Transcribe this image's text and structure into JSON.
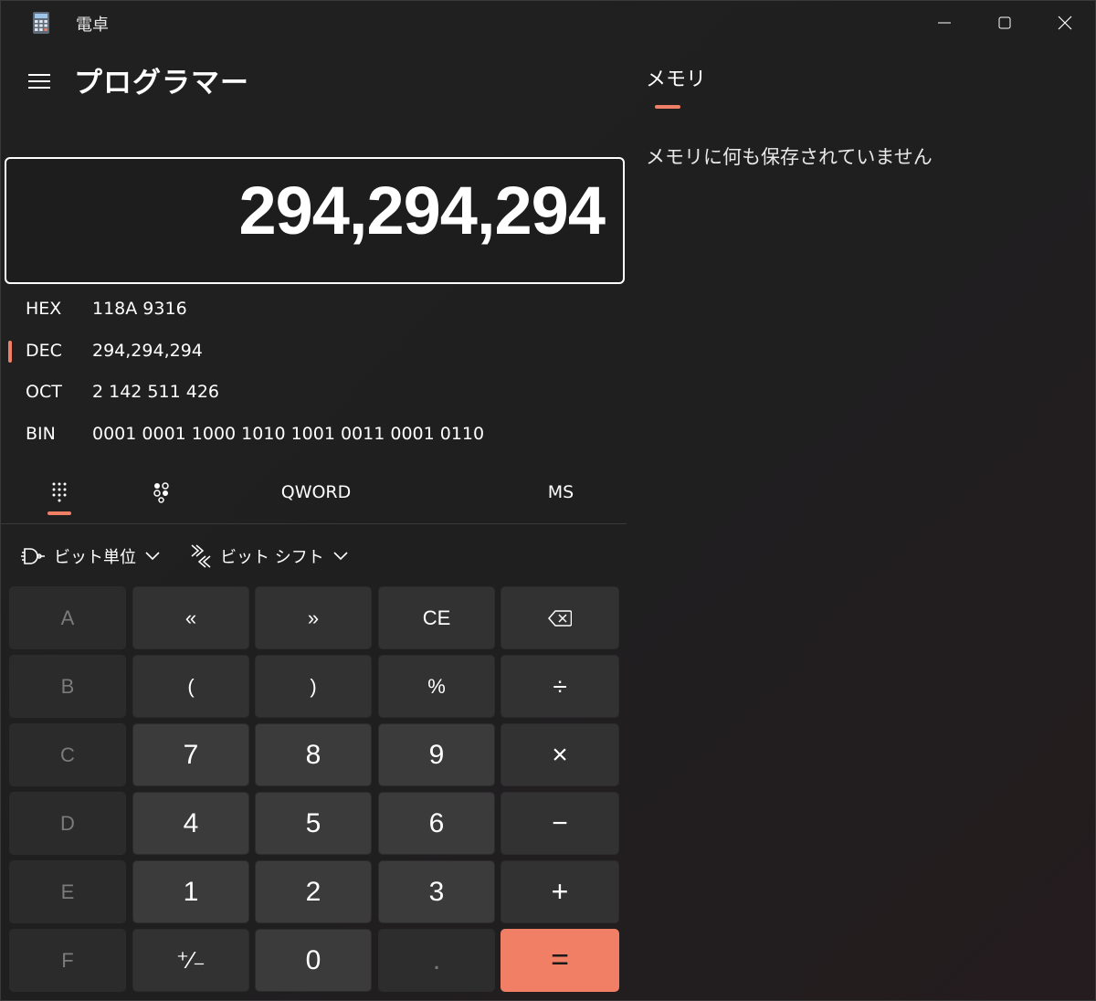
{
  "window": {
    "title": "電卓",
    "accent_color": "#f07f66"
  },
  "header": {
    "menu_icon": "hamburger-icon",
    "mode_title": "プログラマー"
  },
  "display": {
    "value": "294,294,294"
  },
  "radix": [
    {
      "label": "HEX",
      "value": "118A 9316",
      "selected": false
    },
    {
      "label": "DEC",
      "value": "294,294,294",
      "selected": true
    },
    {
      "label": "OCT",
      "value": "2 142 511 426",
      "selected": false
    },
    {
      "label": "BIN",
      "value": "0001 0001 1000 1010 1001 0011 0001 0110",
      "selected": false
    }
  ],
  "tabs": {
    "keypad_icon": "full-keypad-icon",
    "bit_toggle_icon": "bit-toggle-keypad-icon",
    "word_size": "QWORD",
    "memory_store": "MS"
  },
  "dropdowns": {
    "bitwise_label": "ビット単位",
    "bitshift_label": "ビット シフト"
  },
  "keypad": {
    "hex_keys": [
      "A",
      "B",
      "C",
      "D",
      "E",
      "F"
    ],
    "row1": {
      "lshift": "«",
      "rshift": "»",
      "ce": "CE",
      "backspace_icon": "backspace-icon"
    },
    "row2": {
      "lparen": "(",
      "rparen": ")",
      "percent": "%",
      "divide": "÷"
    },
    "row3": {
      "n7": "7",
      "n8": "8",
      "n9": "9",
      "multiply": "×"
    },
    "row4": {
      "n4": "4",
      "n5": "5",
      "n6": "6",
      "minus": "−"
    },
    "row5": {
      "n1": "1",
      "n2": "2",
      "n3": "3",
      "plus": "+"
    },
    "row6": {
      "negate": "⁺∕₋",
      "n0": "0",
      "decimal": ".",
      "equals": "="
    }
  },
  "memory": {
    "tab_label": "メモリ",
    "empty_message": "メモリに何も保存されていません"
  }
}
